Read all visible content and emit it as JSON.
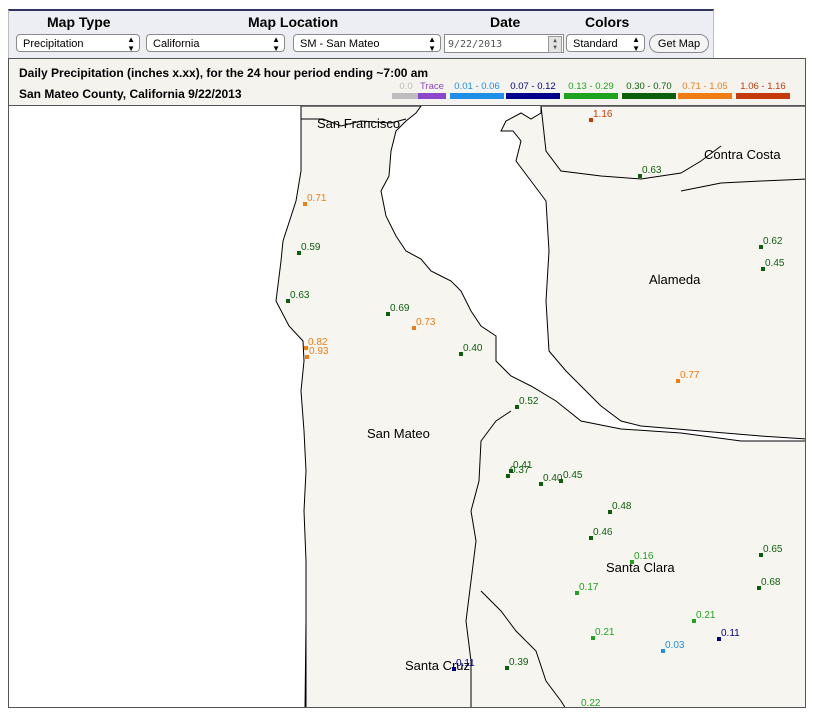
{
  "controls": {
    "map_type_label": "Map Type",
    "map_location_label": "Map Location",
    "date_label": "Date",
    "colors_label": "Colors",
    "map_type_value": "Precipitation",
    "state_value": "California",
    "county_value": "SM - San Mateo",
    "date_value": "9/22/2013",
    "colors_value": "Standard",
    "get_map_label": "Get Map"
  },
  "info": {
    "title": "Daily Precipitation (inches  x.xx),  for the 24 hour period ending ~7:00 am",
    "subtitle": "San Mateo County, California  9/22/2013"
  },
  "legend": [
    {
      "label": "0.0",
      "color": "#bdbdbd",
      "text_color": "#bdbdbd"
    },
    {
      "label": "Trace",
      "color": "#8b47c9",
      "text_color": "#8b47c9"
    },
    {
      "label": "0.01 - 0.06",
      "color": "#1d8fe6",
      "text_color": "#1d8fe6"
    },
    {
      "label": "0.07 - 0.12",
      "color": "#00008b",
      "text_color": "#00008b"
    },
    {
      "label": "0.13 - 0.29",
      "color": "#1ea31e",
      "text_color": "#1ea31e"
    },
    {
      "label": "0.30 - 0.70",
      "color": "#0b5f0b",
      "text_color": "#0b5f0b"
    },
    {
      "label": "0.71 - 1.05",
      "color": "#f07d14",
      "text_color": "#f07d14"
    },
    {
      "label": "1.06 - 1.16",
      "color": "#c43a0a",
      "text_color": "#c43a0a"
    }
  ],
  "map": {
    "land_color": "#f7f5f0",
    "water_color": "#ffffff",
    "county_labels": [
      "San Francisco",
      "Contra Costa",
      "Alameda",
      "San Mateo",
      "Santa Clara",
      "Santa Cruz"
    ],
    "stations": [
      {
        "value": "1.16",
        "category": 7
      },
      {
        "value": "0.63",
        "category": 5
      },
      {
        "value": "0.62",
        "category": 5
      },
      {
        "value": "0.45",
        "category": 5
      },
      {
        "value": "0.71",
        "category": 6
      },
      {
        "value": "0.59",
        "category": 5
      },
      {
        "value": "0.63",
        "category": 5
      },
      {
        "value": "0.69",
        "category": 5
      },
      {
        "value": "0.73",
        "category": 6
      },
      {
        "value": "0.82",
        "category": 6
      },
      {
        "value": "0.93",
        "category": 6
      },
      {
        "value": "0.40",
        "category": 5
      },
      {
        "value": "0.77",
        "category": 6
      },
      {
        "value": "0.52",
        "category": 5
      },
      {
        "value": "0.41",
        "category": 5
      },
      {
        "value": "0.37",
        "category": 5
      },
      {
        "value": "0.40",
        "category": 5
      },
      {
        "value": "0.45",
        "category": 5
      },
      {
        "value": "0.48",
        "category": 5
      },
      {
        "value": "0.46",
        "category": 5
      },
      {
        "value": "0.16",
        "category": 4
      },
      {
        "value": "0.65",
        "category": 5
      },
      {
        "value": "0.68",
        "category": 5
      },
      {
        "value": "0.17",
        "category": 4
      },
      {
        "value": "0.21",
        "category": 4
      },
      {
        "value": "0.21",
        "category": 4
      },
      {
        "value": "0.11",
        "category": 3
      },
      {
        "value": "0.03",
        "category": 2
      },
      {
        "value": "0.11",
        "category": 3
      },
      {
        "value": "0.39",
        "category": 5
      },
      {
        "value": "0.22",
        "category": 4
      }
    ]
  }
}
